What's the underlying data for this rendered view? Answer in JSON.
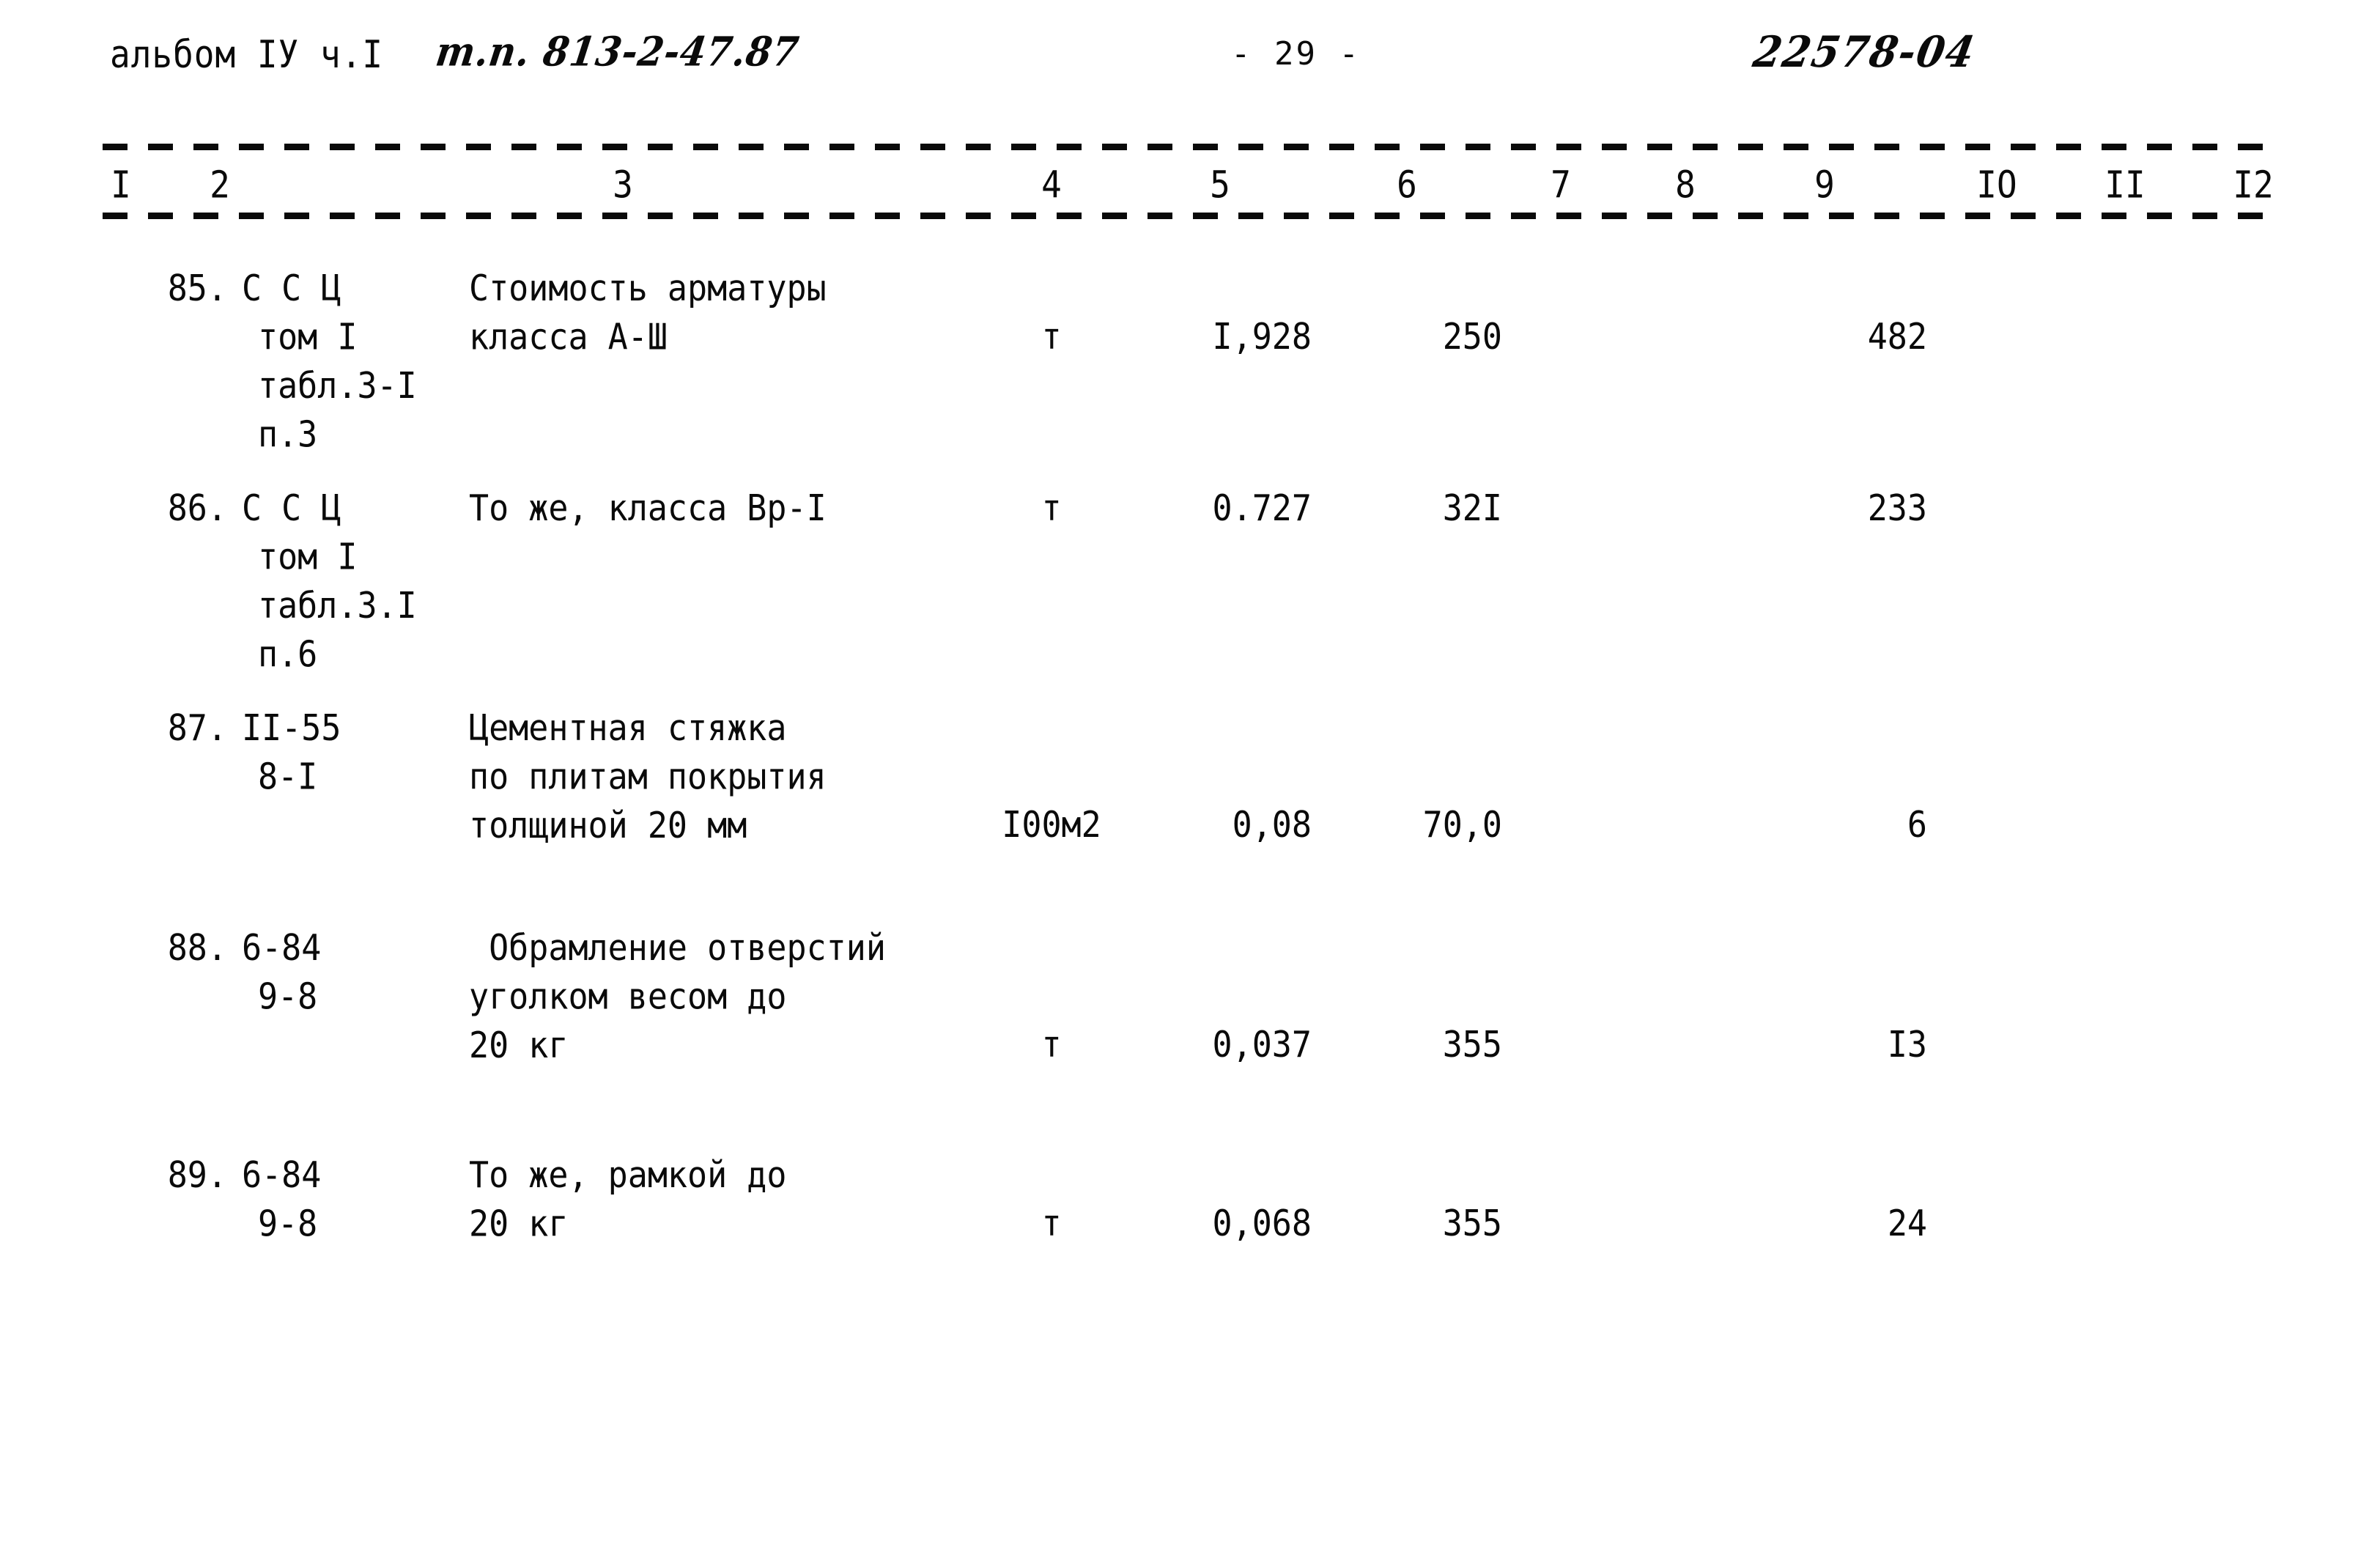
{
  "header": {
    "album": "альбом IУ ч.I",
    "project_code": "т.п. 813-2-47.87",
    "page_number": "- 29 -",
    "doc_code": "22578-04"
  },
  "table": {
    "column_numbers": [
      "I",
      "2",
      "3",
      "4",
      "5",
      "6",
      "7",
      "8",
      "9",
      "IO",
      "II",
      "I2"
    ],
    "rows": [
      {
        "no": "85.",
        "justification": [
          "С С Ц",
          "том I",
          "табл.3-I",
          "п.3"
        ],
        "description": [
          "Стоимость арматуры",
          "класса А-Ш"
        ],
        "unit": "т",
        "quantity": "I,928",
        "price": "250",
        "col7": "",
        "col8": "",
        "total": "482",
        "col10": "",
        "col11": "",
        "col12": "",
        "value_line": 1
      },
      {
        "no": "86.",
        "justification": [
          "С С Ц",
          "том I",
          "табл.3.I",
          "п.6"
        ],
        "description": [
          "То же, класса Вр-I"
        ],
        "unit": "т",
        "quantity": "0.727",
        "price": "32I",
        "col7": "",
        "col8": "",
        "total": "233",
        "col10": "",
        "col11": "",
        "col12": "",
        "value_line": 0
      },
      {
        "no": "87.",
        "justification": [
          "II-55",
          "8-I"
        ],
        "description": [
          "Цементная стяжка",
          "по плитам покрытия",
          "толщиной 20 мм"
        ],
        "unit": "I00м2",
        "quantity": "0,08",
        "price": "70,0",
        "col7": "",
        "col8": "",
        "total": "6",
        "col10": "",
        "col11": "",
        "col12": "",
        "value_line": 2
      },
      {
        "no": "88.",
        "justification": [
          "6-84",
          "9-8"
        ],
        "description": [
          " Обрамление отверстий",
          "уголком весом до",
          "20 кг"
        ],
        "unit": "т",
        "quantity": "0,037",
        "price": "355",
        "col7": "",
        "col8": "",
        "total": "I3",
        "col10": "",
        "col11": "",
        "col12": "",
        "value_line": 2
      },
      {
        "no": "89.",
        "justification": [
          "6-84",
          "9-8"
        ],
        "description": [
          "То же, рамкой до",
          "20 кг"
        ],
        "unit": "т",
        "quantity": "0,068",
        "price": "355",
        "col7": "",
        "col8": "",
        "total": "24",
        "col10": "",
        "col11": "",
        "col12": "",
        "value_line": 1
      }
    ]
  }
}
